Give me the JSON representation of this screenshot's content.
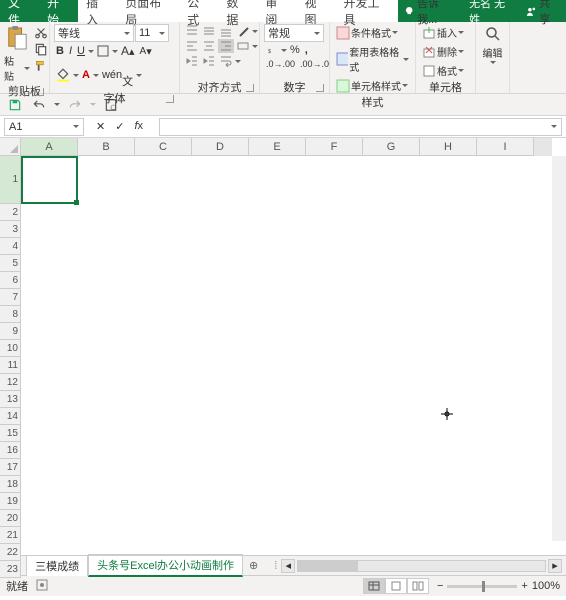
{
  "tabs": {
    "file": "文件",
    "items": [
      "开始",
      "插入",
      "页面布局",
      "公式",
      "数据",
      "审阅",
      "视图",
      "开发工具"
    ],
    "active": 0,
    "tell": "告诉我...",
    "user": "无名 无姓",
    "share": "共享"
  },
  "ribbon": {
    "clipboard": {
      "paste": "粘贴",
      "label": "剪贴板"
    },
    "font": {
      "name": "等线",
      "size": "11",
      "label": "字体"
    },
    "align": {
      "label": "对齐方式"
    },
    "number": {
      "format": "常规",
      "label": "数字"
    },
    "styles": {
      "cond": "条件格式",
      "table": "套用表格格式",
      "cell": "单元格样式",
      "label": "样式"
    },
    "cells": {
      "insert": "插入",
      "delete": "删除",
      "format": "格式",
      "label": "单元格"
    },
    "editing": {
      "label": "编辑"
    }
  },
  "namebox": "A1",
  "columns": [
    "A",
    "B",
    "C",
    "D",
    "E",
    "F",
    "G",
    "H",
    "I"
  ],
  "rows": [
    "1",
    "2",
    "3",
    "4",
    "5",
    "6",
    "7",
    "8",
    "9",
    "10",
    "11",
    "12",
    "13",
    "14",
    "15",
    "16",
    "17",
    "18",
    "19",
    "20",
    "21",
    "22",
    "23"
  ],
  "sheets": {
    "items": [
      "三模成绩",
      "头条号Excel办公小动画制作"
    ],
    "active": 1
  },
  "status": {
    "ready": "就绪",
    "zoom": "100%"
  }
}
